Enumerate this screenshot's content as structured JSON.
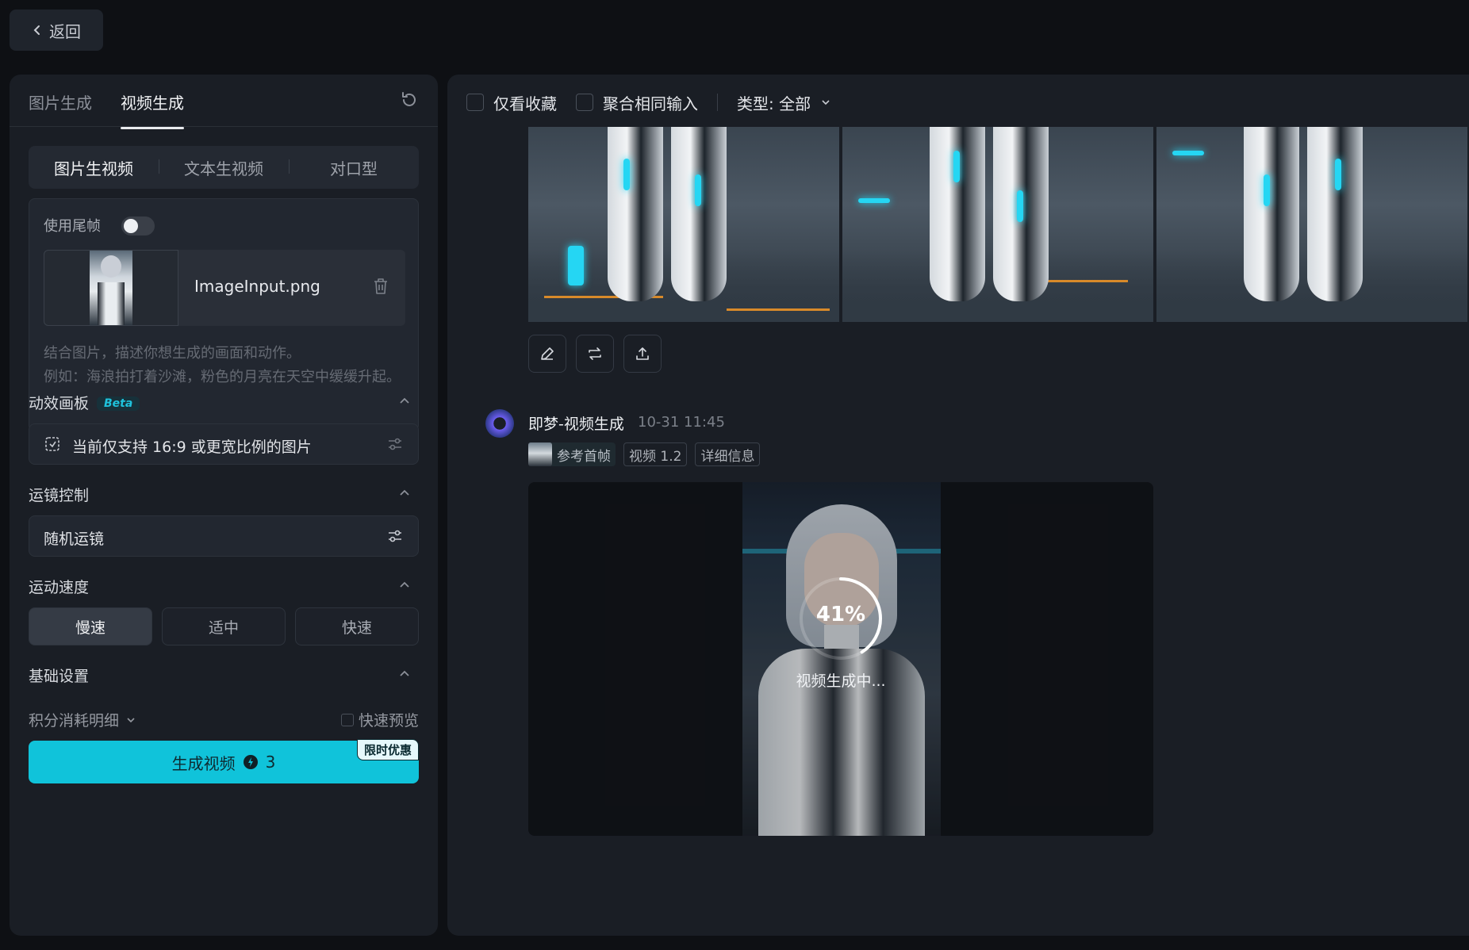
{
  "header": {
    "back_label": "返回"
  },
  "left": {
    "main_tabs": [
      "图片生成",
      "视频生成"
    ],
    "active_main_tab": 1,
    "sub_tabs": [
      "图片生视频",
      "文本生视频",
      "对口型"
    ],
    "active_sub_tab": 0,
    "use_tail_frame_label": "使用尾帧",
    "use_tail_frame_on": false,
    "uploaded_file": "ImageInput.png",
    "prompt_placeholder": "结合图片，描述你想生成的画面和动作。\n例如：海浪拍打着沙滩，粉色的月亮在天空中缓缓升起。",
    "motion_board": {
      "title": "动效画板",
      "badge": "Beta",
      "notice": "当前仅支持 16:9 或更宽比例的图片"
    },
    "camera_control": {
      "title": "运镜控制",
      "value": "随机运镜"
    },
    "motion_speed": {
      "title": "运动速度",
      "options": [
        "慢速",
        "适中",
        "快速"
      ],
      "selected": 0
    },
    "basic_settings": {
      "title": "基础设置"
    },
    "cost_detail_label": "积分消耗明细",
    "quick_preview_label": "快速预览",
    "generate_button": {
      "label": "生成视频",
      "cost": "3",
      "promo": "限时优惠"
    }
  },
  "right": {
    "filters": {
      "favorites_only": "仅看收藏",
      "merge_same_input": "聚合相同输入",
      "type_label": "类型: 全部"
    },
    "generation": {
      "title": "即梦-视频生成",
      "time": "10-31  11:45",
      "ref_tag": "参考首帧",
      "model_tag": "视频 1.2",
      "detail_tag": "详细信息",
      "progress": 41,
      "progress_label": "41%",
      "status_text": "视频生成中..."
    }
  },
  "colors": {
    "accent": "#10c3da",
    "panel_bg": "#1a1e25",
    "page_bg": "#0e1014"
  }
}
